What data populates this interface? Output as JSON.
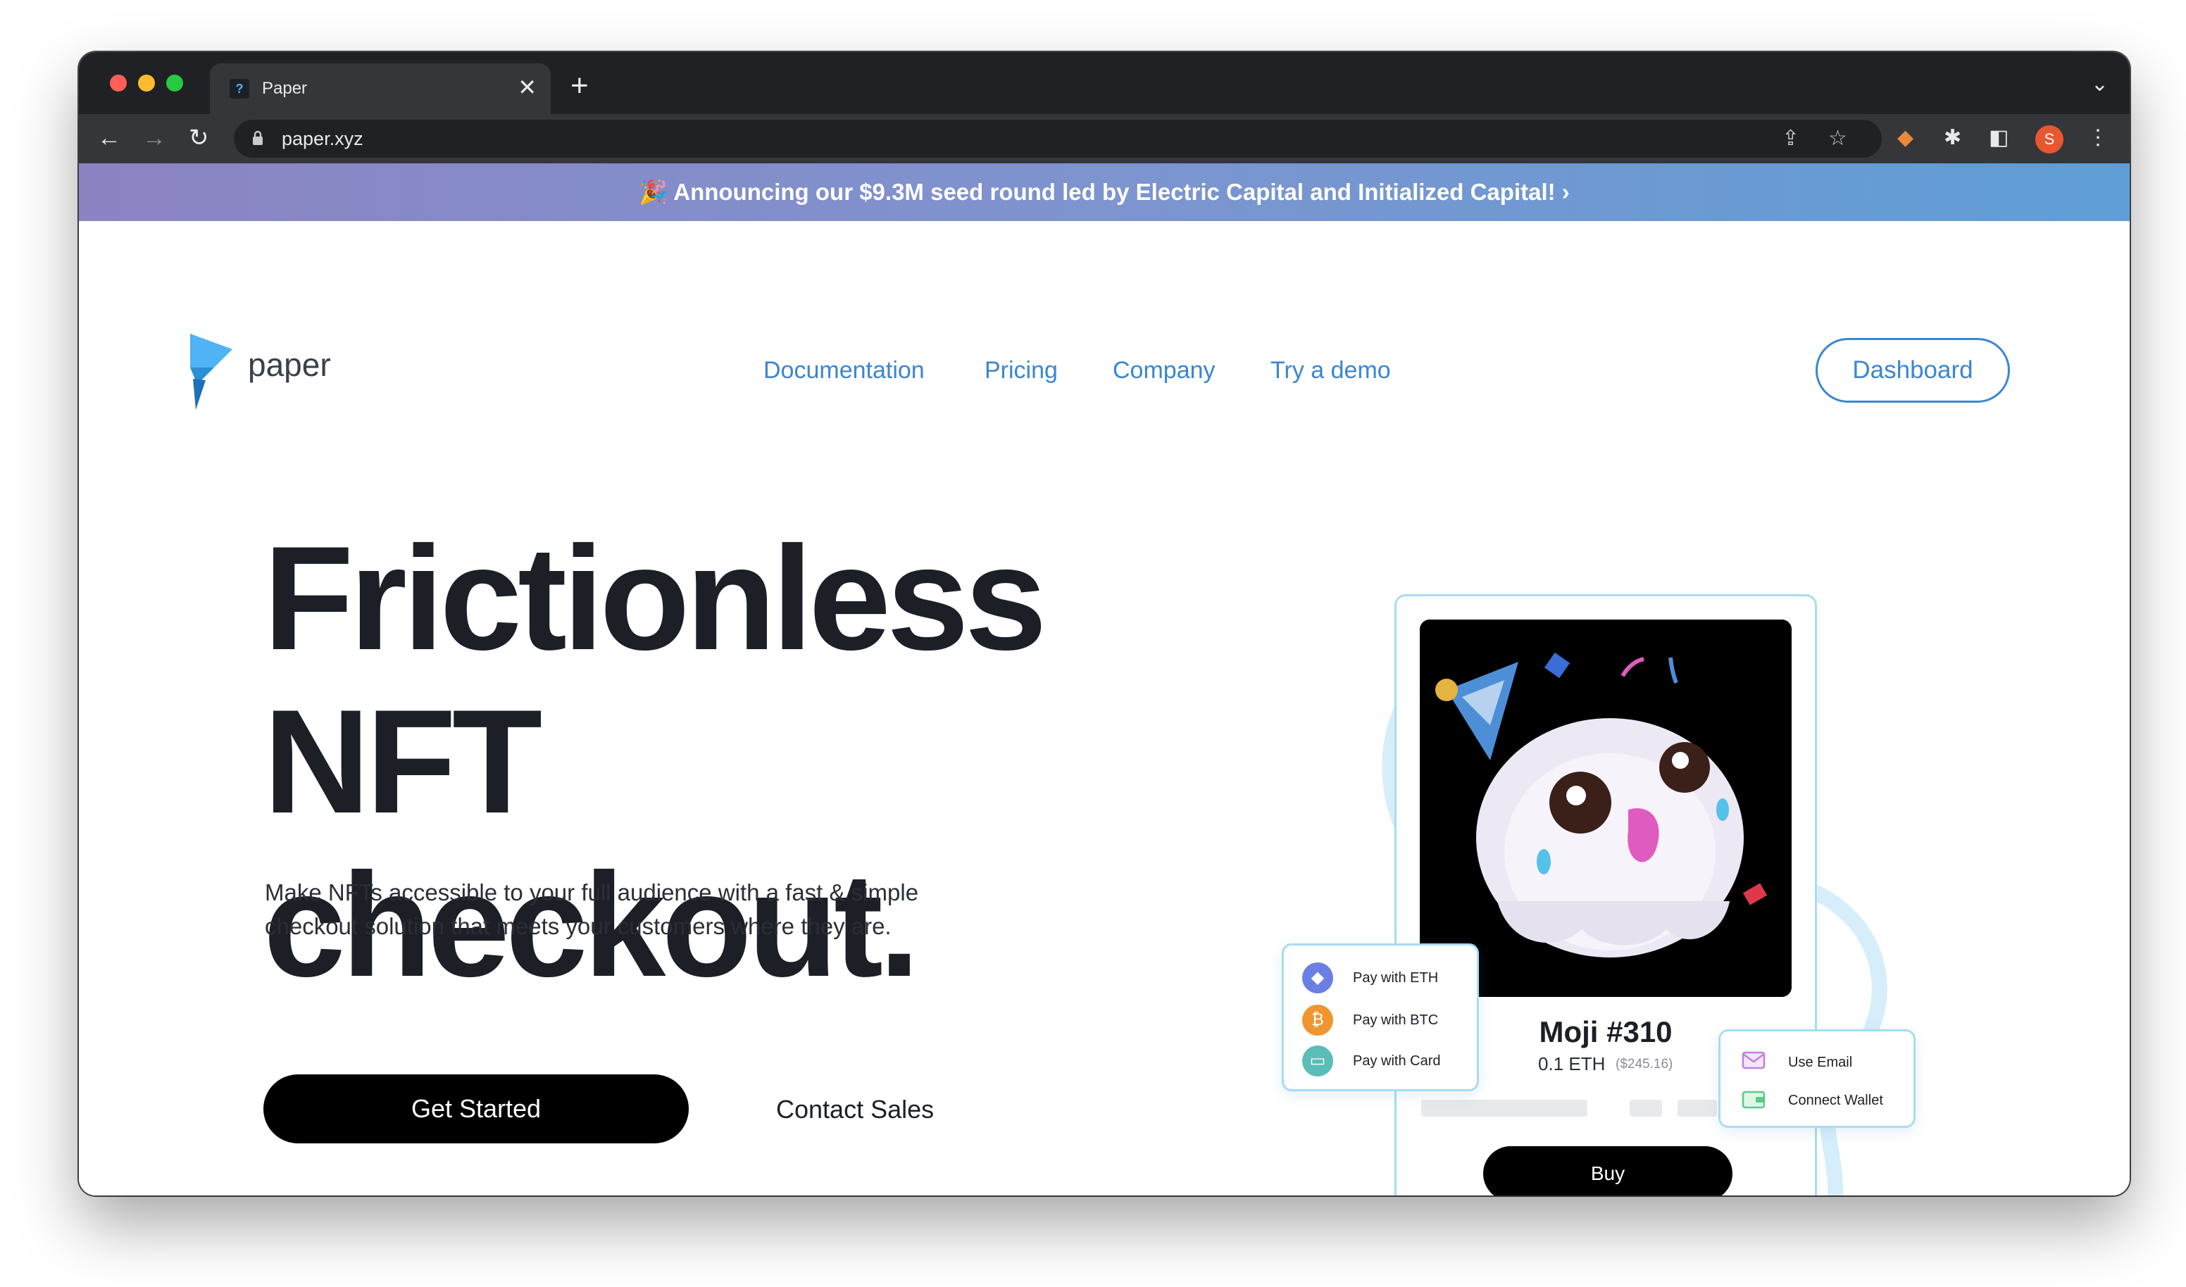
{
  "browser": {
    "tab_title": "Paper",
    "tab_close": "✕",
    "new_tab": "+",
    "url": "paper.xyz",
    "profile_initial": "S",
    "traffic_lights": [
      "#ff5f57",
      "#febc2e",
      "#28c840"
    ]
  },
  "banner": {
    "text": "🎉 Announcing our $9.3M seed round led by Electric Capital and Initialized Capital! ›"
  },
  "nav": {
    "logo_text": "paper",
    "links": [
      "Documentation",
      "Pricing",
      "Company",
      "Try a demo"
    ],
    "dashboard_label": "Dashboard"
  },
  "hero": {
    "headline_line1": "Frictionless NFT",
    "headline_line2": "checkout.",
    "subheading_line1": "Make NFTs accessible to your full audience with a fast & simple",
    "subheading_line2": "checkout solution that meets your customers where they are.",
    "cta_primary": "Get Started",
    "cta_secondary": "Contact Sales"
  },
  "checkout_card": {
    "nft_name": "Moji #310",
    "price": "0.1 ETH",
    "price_usd": "($245.16)",
    "buy_label": "Buy"
  },
  "payment_options": [
    {
      "label": "Pay with ETH",
      "icon": "ethereum-icon",
      "symbol": "◆",
      "color": "#6b7fe3"
    },
    {
      "label": "Pay with BTC",
      "icon": "bitcoin-icon",
      "symbol": "₿",
      "color": "#f0962f"
    },
    {
      "label": "Pay with Card",
      "icon": "credit-card-icon",
      "symbol": "▭",
      "color": "#5bbcb8"
    }
  ],
  "login_options": [
    {
      "label": "Use Email",
      "icon": "envelope-icon"
    },
    {
      "label": "Connect Wallet",
      "icon": "wallet-icon"
    }
  ],
  "colors": {
    "accent_blue": "#3a86d1",
    "headline": "#1c1f26",
    "card_border": "#a8dcf3"
  }
}
